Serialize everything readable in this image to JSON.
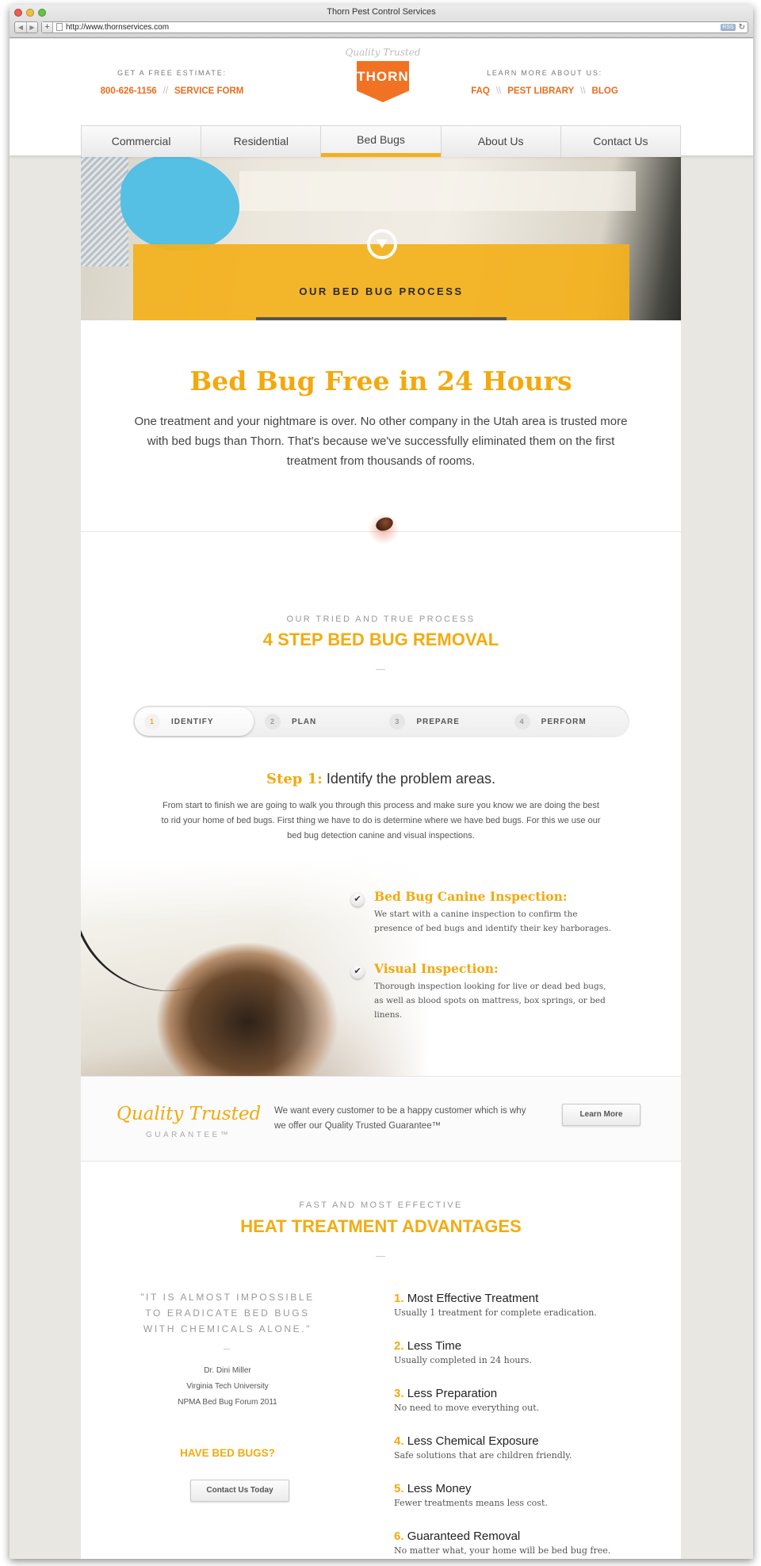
{
  "browser": {
    "window_title": "Thorn Pest Control Services",
    "url": "http://www.thornservices.com",
    "rss_label": "RSS",
    "back_icon": "◀",
    "forward_icon": "▶",
    "add_icon": "+",
    "reload_icon": "↻"
  },
  "header": {
    "left_label": "GET A FREE ESTIMATE:",
    "phone": "800-626-1156",
    "left_sep": "//",
    "service_form": "SERVICE FORM",
    "logo_script": "Quality Trusted",
    "logo_text": "THORN",
    "right_label": "LEARN MORE ABOUT US:",
    "faq": "FAQ",
    "right_sep": "\\\\",
    "pest_library": "PEST LIBRARY",
    "blog": "BLOG"
  },
  "nav": {
    "items": [
      {
        "label": "Commercial"
      },
      {
        "label": "Residential"
      },
      {
        "label": "Bed Bugs",
        "active": true
      },
      {
        "label": "About Us"
      },
      {
        "label": "Contact Us"
      }
    ]
  },
  "hero": {
    "title": "OUR BED BUG PROCESS"
  },
  "intro": {
    "title": "Bed Bug Free in 24 Hours",
    "text": "One treatment and your nightmare is over. No other company in the Utah area is trusted more with bed bugs than Thorn. That's because we've successfully eliminated them on the first treatment from thousands of rooms."
  },
  "process": {
    "kicker": "OUR TRIED AND TRUE PROCESS",
    "title": "4 STEP BED BUG REMOVAL",
    "steps": [
      {
        "num": "1",
        "label": "IDENTIFY",
        "active": true
      },
      {
        "num": "2",
        "label": "PLAN"
      },
      {
        "num": "3",
        "label": "PREPARE"
      },
      {
        "num": "4",
        "label": "PERFORM"
      }
    ],
    "step_head_accent": "Step 1:",
    "step_head_text": "Identify the problem areas.",
    "step_text": "From start to finish we are going to walk you through this process and make sure you know we are doing the best to rid your home of bed bugs. First thing we have to do is determine where we have bed bugs. For this we use our bed bug detection canine and visual inspections.",
    "features": [
      {
        "title": "Bed Bug Canine Inspection:",
        "text": "We start with a canine inspection to confirm the presence of bed bugs and identify their key harborages."
      },
      {
        "title": "Visual Inspection:",
        "text": "Thorough inspection looking for live or dead bed bugs, as well as blood spots on mattress, box springs, or bed linens."
      }
    ],
    "check_icon": "✔"
  },
  "guarantee": {
    "script": "Quality Trusted",
    "sub": "GUARANTEE™",
    "text": "We want every customer to be a happy customer which is why we offer our Quality Trusted Guarantee™",
    "button": "Learn More"
  },
  "advantages": {
    "kicker": "FAST AND MOST EFFECTIVE",
    "title": "HEAT TREATMENT ADVANTAGES",
    "quote": "\"IT IS ALMOST IMPOSSIBLE TO ERADICATE BED BUGS WITH CHEMICALS ALONE.\"",
    "attrib_name": "Dr. Dini Miller",
    "attrib_org": "Virginia Tech University",
    "attrib_event": "NPMA Bed Bug Forum 2011",
    "cta_title": "HAVE BED BUGS?",
    "cta_button": "Contact Us Today",
    "items": [
      {
        "num": "1.",
        "title": "Most Effective Treatment",
        "text": "Usually 1 treatment for complete eradication."
      },
      {
        "num": "2.",
        "title": "Less Time",
        "text": "Usually completed in 24 hours."
      },
      {
        "num": "3.",
        "title": "Less Preparation",
        "text": "No need to move everything out."
      },
      {
        "num": "4.",
        "title": "Less Chemical Exposure",
        "text": "Safe solutions that are children friendly."
      },
      {
        "num": "5.",
        "title": "Less Money",
        "text": "Fewer treatments means less cost."
      },
      {
        "num": "6.",
        "title": "Guaranteed Removal",
        "text": "No matter what, your home will be bed bug free."
      }
    ]
  },
  "colors": {
    "accent_yellow": "#f3a90d",
    "brand_orange": "#f07222",
    "link_orange": "#ea6d1d"
  }
}
